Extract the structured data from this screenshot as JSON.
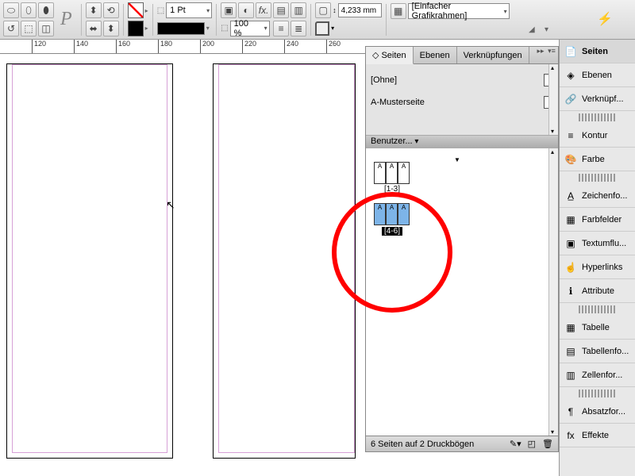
{
  "toolbar": {
    "stroke_weight": "1 Pt",
    "zoom": "100 %",
    "measurement": "4,233 mm",
    "frame_type": "[Einfacher Grafikrahmen]"
  },
  "ruler": {
    "ticks": [
      {
        "pos": 40,
        "label": "120"
      },
      {
        "pos": 93,
        "label": "140"
      },
      {
        "pos": 146,
        "label": "160"
      },
      {
        "pos": 199,
        "label": "180"
      },
      {
        "pos": 252,
        "label": "200"
      },
      {
        "pos": 305,
        "label": "220"
      },
      {
        "pos": 358,
        "label": "240"
      },
      {
        "pos": 411,
        "label": "260"
      }
    ]
  },
  "panel": {
    "tabs": {
      "pages": "Seiten",
      "layers": "Ebenen",
      "links": "Verknüpfungen"
    },
    "masters": {
      "none": "[Ohne]",
      "a": "A-Musterseite"
    },
    "section_head": "Benutzer...",
    "spreads": [
      {
        "label": "[1-3]",
        "pages": [
          "A",
          "A",
          "A"
        ],
        "selected": false
      },
      {
        "label": "[4-6]",
        "pages": [
          "A",
          "A",
          "A"
        ],
        "selected": true
      }
    ],
    "status": "6 Seiten auf 2 Druckbögen"
  },
  "dock": {
    "items": [
      {
        "icon": "📄",
        "label": "Seiten",
        "active": true
      },
      {
        "icon": "◈",
        "label": "Ebenen"
      },
      {
        "icon": "🔗",
        "label": "Verknüpf..."
      },
      {
        "gap": true
      },
      {
        "icon": "≡",
        "label": "Kontur"
      },
      {
        "icon": "🎨",
        "label": "Farbe"
      },
      {
        "gap": true
      },
      {
        "icon": "A̲",
        "label": "Zeichenfo..."
      },
      {
        "icon": "▦",
        "label": "Farbfelder"
      },
      {
        "icon": "▣",
        "label": "Textumflu..."
      },
      {
        "icon": "☝",
        "label": "Hyperlinks"
      },
      {
        "icon": "ℹ",
        "label": "Attribute"
      },
      {
        "gap": true
      },
      {
        "icon": "▦",
        "label": "Tabelle"
      },
      {
        "icon": "▤",
        "label": "Tabellenfo..."
      },
      {
        "icon": "▥",
        "label": "Zellenfor..."
      },
      {
        "gap": true
      },
      {
        "icon": "¶",
        "label": "Absatzfor..."
      },
      {
        "icon": "fx",
        "label": "Effekte"
      }
    ]
  }
}
